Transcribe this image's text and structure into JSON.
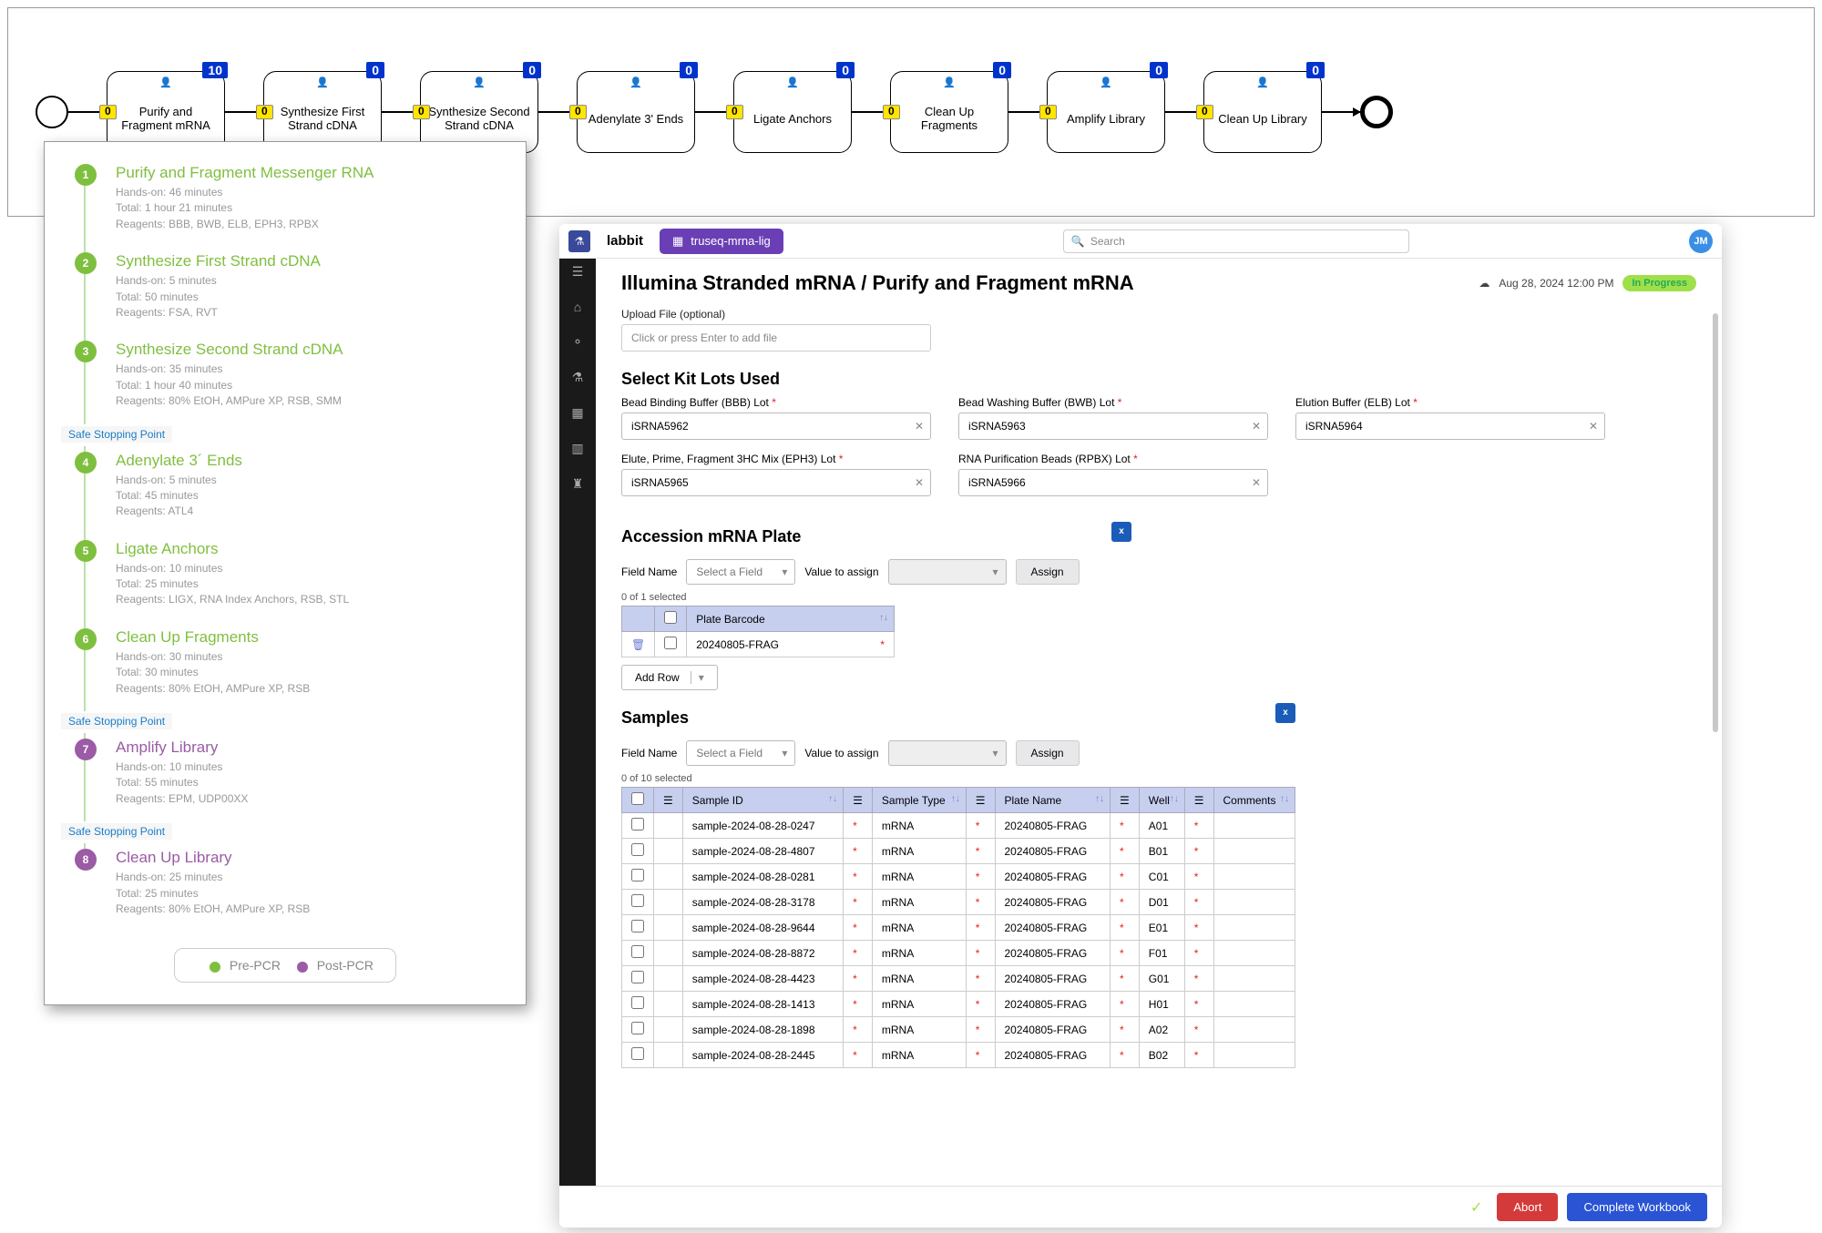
{
  "workflow": {
    "nodes": [
      {
        "label": "Purify and Fragment mRNA",
        "blue": "10",
        "yellow": "0"
      },
      {
        "label": "Synthesize First Strand cDNA",
        "blue": "0",
        "yellow": "0"
      },
      {
        "label": "Synthesize Second Strand cDNA",
        "blue": "0",
        "yellow": "0"
      },
      {
        "label": "Adenylate 3' Ends",
        "blue": "0",
        "yellow": "0"
      },
      {
        "label": "Ligate Anchors",
        "blue": "0",
        "yellow": "0"
      },
      {
        "label": "Clean Up Fragments",
        "blue": "0",
        "yellow": "0"
      },
      {
        "label": "Amplify Library",
        "blue": "0",
        "yellow": "0"
      },
      {
        "label": "Clean Up Library",
        "blue": "0",
        "yellow": "0"
      }
    ]
  },
  "protocol": {
    "stopping_label": "Safe Stopping Point",
    "steps": [
      {
        "n": "1",
        "color": "green",
        "title": "Purify and Fragment Messenger RNA",
        "hands": "Hands-on: 46 minutes",
        "total": "Total: 1 hour 21 minutes",
        "reagents": "Reagents: BBB, BWB, ELB, EPH3, RPBX",
        "stop": false
      },
      {
        "n": "2",
        "color": "green",
        "title": "Synthesize First Strand cDNA",
        "hands": "Hands-on: 5 minutes",
        "total": "Total: 50 minutes",
        "reagents": "Reagents: FSA, RVT",
        "stop": false
      },
      {
        "n": "3",
        "color": "green",
        "title": "Synthesize Second Strand cDNA",
        "hands": "Hands-on: 35 minutes",
        "total": "Total: 1 hour 40 minutes",
        "reagents": "Reagents: 80% EtOH, AMPure XP, RSB, SMM",
        "stop": true
      },
      {
        "n": "4",
        "color": "green",
        "title": "Adenylate 3´ Ends",
        "hands": "Hands-on: 5 minutes",
        "total": "Total: 45 minutes",
        "reagents": "Reagents: ATL4",
        "stop": false
      },
      {
        "n": "5",
        "color": "green",
        "title": "Ligate Anchors",
        "hands": "Hands-on: 10 minutes",
        "total": "Total: 25 minutes",
        "reagents": "Reagents: LIGX, RNA Index Anchors, RSB, STL",
        "stop": false
      },
      {
        "n": "6",
        "color": "green",
        "title": "Clean Up Fragments",
        "hands": "Hands-on: 30 minutes",
        "total": "Total: 30 minutes",
        "reagents": "Reagents: 80% EtOH, AMPure XP, RSB",
        "stop": true
      },
      {
        "n": "7",
        "color": "purple",
        "title": "Amplify Library",
        "hands": "Hands-on: 10 minutes",
        "total": "Total: 55 minutes",
        "reagents": "Reagents: EPM, UDP00XX",
        "stop": true
      },
      {
        "n": "8",
        "color": "purple",
        "title": "Clean Up Library",
        "hands": "Hands-on: 25 minutes",
        "total": "Total: 25 minutes",
        "reagents": "Reagents: 80% EtOH, AMPure XP, RSB",
        "stop": false
      }
    ],
    "legend": {
      "pre": "Pre-PCR",
      "post": "Post-PCR"
    }
  },
  "app": {
    "logo": "labbit",
    "tab": "truseq-mrna-lig",
    "search_placeholder": "Search",
    "avatar": "JM",
    "title": "Illumina Stranded mRNA / Purify and Fragment mRNA",
    "timestamp": "Aug 28, 2024 12:00 PM",
    "status": "In Progress",
    "upload": {
      "label": "Upload File (optional)",
      "placeholder": "Click or press Enter to add file"
    },
    "kit_heading": "Select Kit Lots Used",
    "kit_fields": [
      {
        "label": "Bead Binding Buffer (BBB) Lot",
        "req": "*",
        "value": "iSRNA5962"
      },
      {
        "label": "Bead Washing Buffer (BWB) Lot",
        "req": "*",
        "value": "iSRNA5963"
      },
      {
        "label": "Elution Buffer (ELB) Lot",
        "req": "*",
        "value": "iSRNA5964"
      },
      {
        "label": "Elute, Prime, Fragment 3HC Mix (EPH3) Lot",
        "req": "*",
        "value": "iSRNA5965"
      },
      {
        "label": "RNA Purification Beads (RPBX) Lot",
        "req": "*",
        "value": "iSRNA5966"
      }
    ],
    "accession": {
      "heading": "Accession mRNA Plate",
      "field_name_label": "Field Name",
      "select_placeholder": "Select a Field",
      "value_label": "Value to assign",
      "assign": "Assign",
      "count": "0 of 1 selected",
      "header": "Plate Barcode",
      "row": "20240805-FRAG",
      "add_row": "Add Row"
    },
    "samples": {
      "heading": "Samples",
      "field_name_label": "Field Name",
      "select_placeholder": "Select a Field",
      "value_label": "Value to assign",
      "assign": "Assign",
      "count": "0 of 10 selected",
      "headers": [
        "Sample ID",
        "Sample Type",
        "Plate Name",
        "Well",
        "Comments"
      ],
      "rows": [
        {
          "id": "sample-2024-08-28-0247",
          "type": "mRNA",
          "plate": "20240805-FRAG",
          "well": "A01"
        },
        {
          "id": "sample-2024-08-28-4807",
          "type": "mRNA",
          "plate": "20240805-FRAG",
          "well": "B01"
        },
        {
          "id": "sample-2024-08-28-0281",
          "type": "mRNA",
          "plate": "20240805-FRAG",
          "well": "C01"
        },
        {
          "id": "sample-2024-08-28-3178",
          "type": "mRNA",
          "plate": "20240805-FRAG",
          "well": "D01"
        },
        {
          "id": "sample-2024-08-28-9644",
          "type": "mRNA",
          "plate": "20240805-FRAG",
          "well": "E01"
        },
        {
          "id": "sample-2024-08-28-8872",
          "type": "mRNA",
          "plate": "20240805-FRAG",
          "well": "F01"
        },
        {
          "id": "sample-2024-08-28-4423",
          "type": "mRNA",
          "plate": "20240805-FRAG",
          "well": "G01"
        },
        {
          "id": "sample-2024-08-28-1413",
          "type": "mRNA",
          "plate": "20240805-FRAG",
          "well": "H01"
        },
        {
          "id": "sample-2024-08-28-1898",
          "type": "mRNA",
          "plate": "20240805-FRAG",
          "well": "A02"
        },
        {
          "id": "sample-2024-08-28-2445",
          "type": "mRNA",
          "plate": "20240805-FRAG",
          "well": "B02"
        }
      ]
    },
    "footer": {
      "abort": "Abort",
      "complete": "Complete Workbook"
    }
  }
}
